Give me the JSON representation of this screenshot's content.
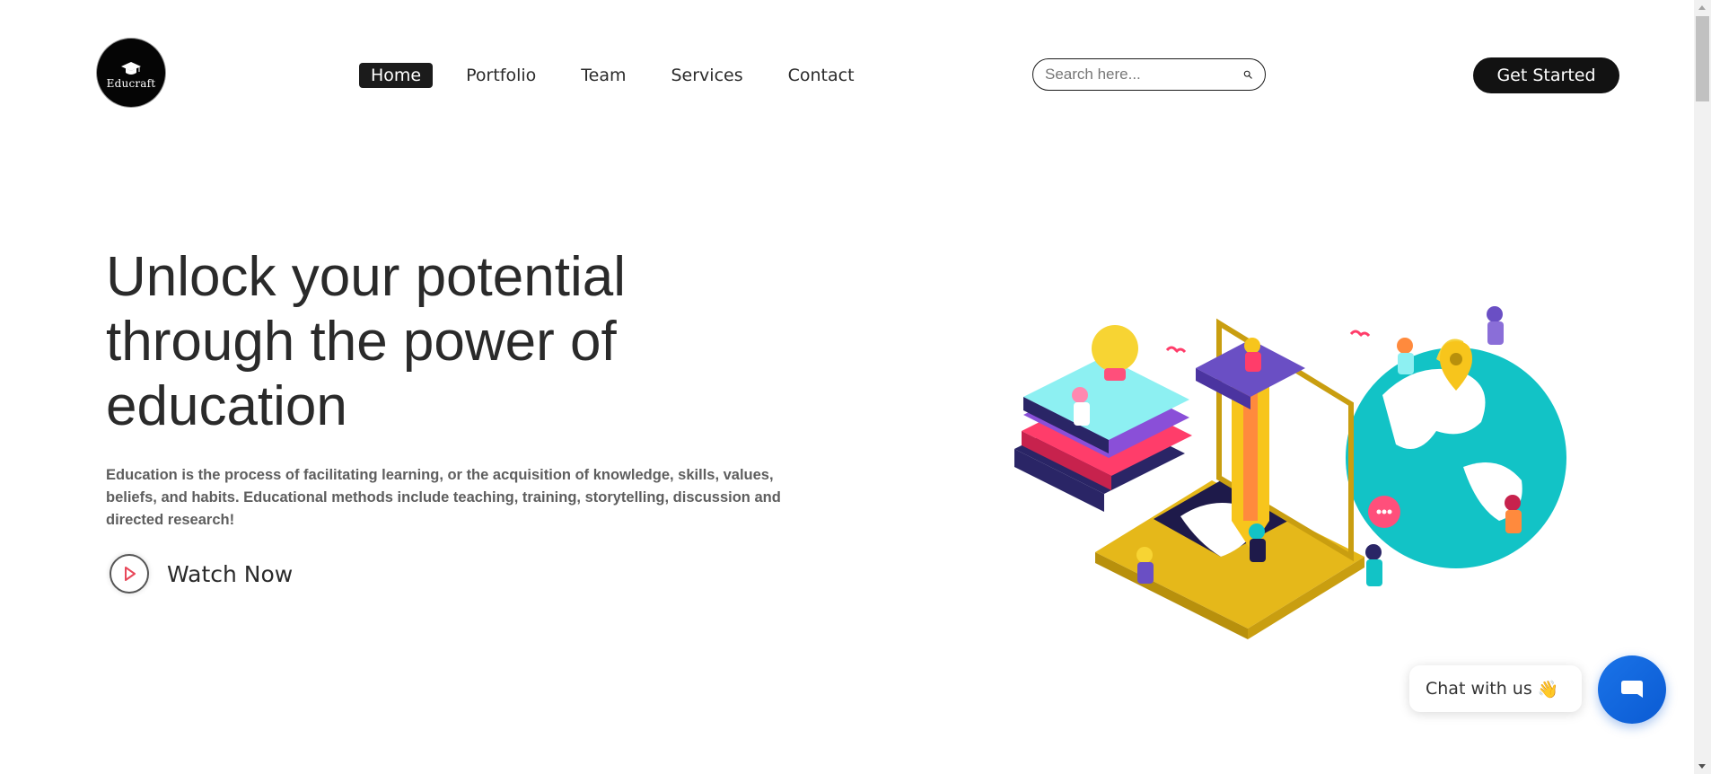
{
  "header": {
    "logo_text": "Educraft",
    "nav": [
      {
        "label": "Home",
        "active": true
      },
      {
        "label": "Portfolio",
        "active": false
      },
      {
        "label": "Team",
        "active": false
      },
      {
        "label": "Services",
        "active": false
      },
      {
        "label": "Contact",
        "active": false
      }
    ],
    "search": {
      "placeholder": "Search here...",
      "value": ""
    },
    "cta_label": "Get Started"
  },
  "hero": {
    "title": "Unlock your potential through the power of education",
    "description": "Education is the process of facilitating learning, or the acquisition of knowledge, skills, values, beliefs, and habits. Educational methods include teaching, training, storytelling, discussion and directed research!",
    "watch_label": "Watch Now"
  },
  "chat": {
    "label": "Chat with us",
    "wave_emoji": "👋"
  },
  "colors": {
    "primary_dark": "#121212",
    "chat_blue": "#1a73e8",
    "play_red": "#e8485a",
    "illus_yellow": "#f2c21d",
    "illus_teal": "#10c5c8",
    "illus_purple": "#6a4fc4",
    "illus_pink": "#ff3d6a"
  }
}
